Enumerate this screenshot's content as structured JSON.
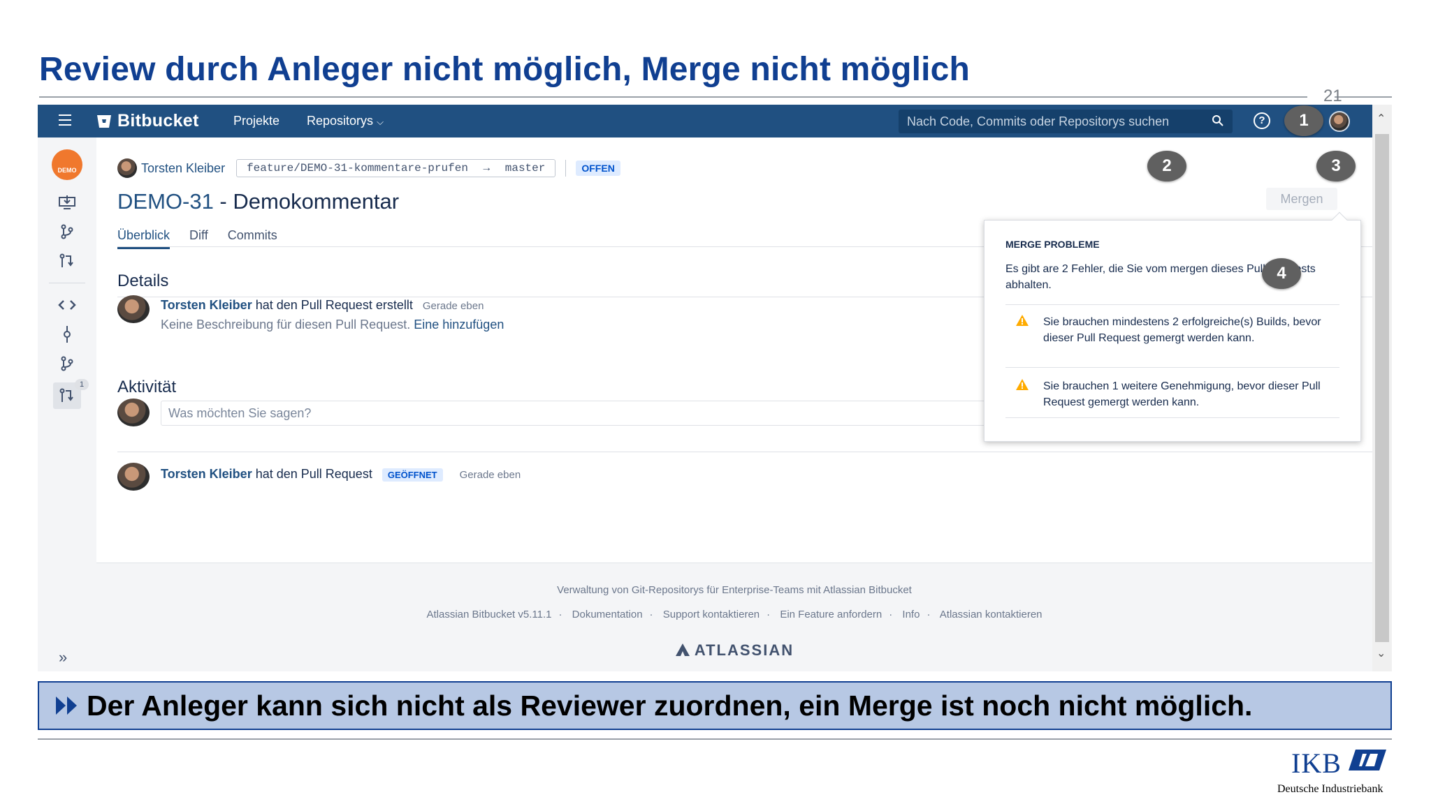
{
  "slide": {
    "title": "Review durch Anleger nicht möglich, Merge nicht möglich",
    "page_number": "21",
    "note": "Der Anleger kann sich nicht als Reviewer zuordnen, ein Merge ist noch nicht möglich.",
    "logo_word": "IKB",
    "logo_subtitle": "Deutsche Industriebank"
  },
  "topbar": {
    "brand": "Bitbucket",
    "nav": [
      "Projekte",
      "Repositorys"
    ],
    "search_placeholder": "Nach Code, Commits oder Repositorys suchen",
    "icons": [
      "menu-icon",
      "bitbucket-logo-icon",
      "chevron-down-icon",
      "search-icon",
      "help-icon",
      "user-avatar"
    ]
  },
  "sidebar": {
    "project_avatar_label": "DEMO",
    "pr_count_badge": "1",
    "icons": [
      "project-avatar",
      "clone-icon",
      "create-branch-icon",
      "create-pull-request-icon",
      "source-icon",
      "commits-icon",
      "branches-icon",
      "pull-requests-icon",
      "expand-icon"
    ]
  },
  "pull_request": {
    "author": "Torsten Kleiber",
    "source_branch": "feature/DEMO-31-kommentare-prufen",
    "arrow": "→",
    "target_branch": "master",
    "status": "OFFEN",
    "key": "DEMO-31",
    "separator": " - ",
    "title": "Demokommentar",
    "tabs": [
      "Überblick",
      "Diff",
      "Commits"
    ],
    "merge_button": "Mergen"
  },
  "details": {
    "heading": "Details",
    "author": "Torsten Kleiber",
    "action": " hat den Pull Request erstellt",
    "time": "Gerade eben",
    "no_description": "Keine Beschreibung für diesen Pull Request. ",
    "add_link": "Eine hinzufügen"
  },
  "activity": {
    "heading": "Aktivität",
    "comment_placeholder": "Was möchten Sie sagen?",
    "author": "Torsten Kleiber",
    "action": " hat den Pull Request",
    "badge": "GEÖFFNET",
    "time": "Gerade eben"
  },
  "merge_popup": {
    "heading": "MERGE PROBLEME",
    "intro": "Es gibt are 2 Fehler, die Sie vom mergen dieses Pull Requests abhalten.",
    "problems": [
      "Sie brauchen mindestens 2 erfolgreiche(s) Builds, bevor dieser Pull Request gemergt werden kann.",
      "Sie brauchen 1 weitere Genehmigung, bevor dieser Pull Request gemergt werden kann."
    ]
  },
  "callouts": [
    "1",
    "2",
    "3",
    "4"
  ],
  "footer": {
    "tagline": "Verwaltung von Git-Repositorys für Enterprise-Teams mit Atlassian Bitbucket",
    "links": [
      "Atlassian Bitbucket v5.11.1",
      "Dokumentation",
      "Support kontaktieren",
      "Ein Feature anfordern",
      "Info",
      "Atlassian kontaktieren"
    ],
    "link_separator": "·",
    "brand": "ATLASSIAN"
  },
  "colors": {
    "slide_title": "#103f91",
    "topbar": "#205081",
    "link": "#205081",
    "note_bar": "#b7c8e4",
    "callout": "#606060",
    "warning": "#ffab00"
  }
}
